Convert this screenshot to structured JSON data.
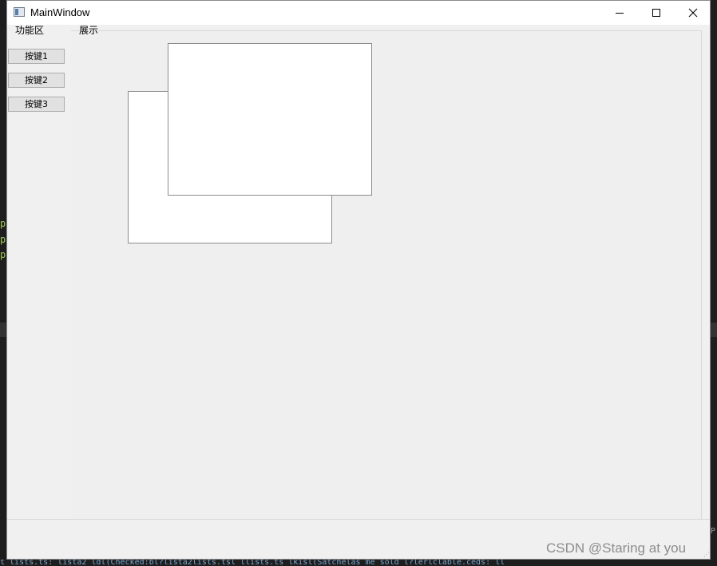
{
  "window": {
    "title": "MainWindow"
  },
  "groups": {
    "function_area_label": "功能区",
    "display_label": "展示"
  },
  "buttons": [
    {
      "label": "按键1"
    },
    {
      "label": "按键2"
    },
    {
      "label": "按键3"
    }
  ],
  "watermark": "CSDN @Staring at you",
  "background": {
    "left_glyphs": [
      "p",
      "p",
      "p"
    ],
    "bottom_code": "t_lists.ts: lista2 ldl(Checked:bl?lista2lists.tsl llists.ts lkisl(Satchelas me sold l?lerlclable.ceds: ll"
  },
  "colors": {
    "window_bg": "#f0f0f0",
    "titlebar_bg": "#ffffff",
    "panel_bg": "#ffffff",
    "editor_bg": "#1e1e1e"
  }
}
